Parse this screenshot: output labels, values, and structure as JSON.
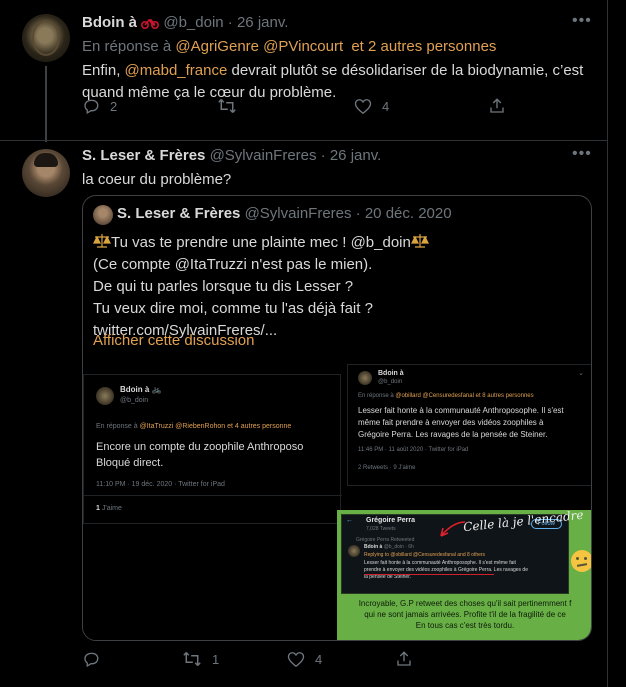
{
  "tweet1": {
    "name": "Bdoin à",
    "handle": "@b_doin",
    "sep": "·",
    "date": "26 janv.",
    "reply_prefix": "En réponse à",
    "reply_users": "@AgriGenre @PVincourt",
    "reply_others": "et 2 autres personnes",
    "text_a": "Enfin,",
    "mention": "@mabd_france",
    "text_b": "devrait plutôt se désolidariser de la biodynamie, c’est",
    "text_c": "quand même ça le cœur du problème.",
    "reply_count": "2",
    "like_count": "4"
  },
  "tweet2": {
    "name": "S. Leser & Frères",
    "handle": "@SylvainFreres",
    "sep": "·",
    "date": "26 janv.",
    "text": "la coeur du problème?",
    "retweet_count": "1",
    "like_count": "4"
  },
  "quote": {
    "name": "S. Leser & Frères",
    "handle": "@SylvainFreres",
    "sep": "·",
    "date": "20 déc. 2020",
    "line1": "Tu vas te prendre une plainte mec ! @b_doin",
    "line2": "(Ce compte @ItaTruzzi n'est pas le mien).",
    "line3": "De qui tu parles lorsque tu dis Lesser ?",
    "line4": "Tu veux dire moi, comme tu l'as déjà fait ?",
    "link": "twitter.com/SylvainFreres/...",
    "show_thread": "Afficher cette discussion"
  },
  "shot_left": {
    "name": "Bdoin à",
    "handle": "@b_doin",
    "reply_prefix": "En réponse à",
    "reply_users": "@ItaTruzzi @RiebenRohon",
    "reply_others": "et 4 autres personne",
    "line1": "Encore un compte du zoophile Anthroposo",
    "line2": "Bloqué direct.",
    "meta": "11:10 PM · 19 déc. 2020 · Twitter for iPad",
    "likes": "1",
    "likes_label": "J'aime"
  },
  "shot_right": {
    "name": "Bdoin à",
    "handle": "@b_doin",
    "reply_prefix": "En réponse à",
    "reply_users": "@obillard @Censuredesfanal",
    "reply_others": "et 8 autres personnes",
    "line1": "Lesser fait honte à la communauté Anthroposophe. Il s'est",
    "line2": "même fait prendre à envoyer des vidéos zoophiles à",
    "line3": "Grégoire Perra. Les ravages de la pensée de Steiner.",
    "meta": "11:46 PM · 11 août 2020 · Twitter for iPad",
    "stats": "2 Retweets · 9 J'aime"
  },
  "shot_green": {
    "profile_name": "Grégoire Perra",
    "profile_sub": "7,028 Tweets",
    "follow": "Follow",
    "annotation": "Celle là je l'encadre",
    "retweeted": "Grégoire Perra Retweeted",
    "inner_name": "Bdoin à",
    "inner_handle": "@b_doin · 6h",
    "inner_reply": "Replying to @obillard @Censuredesfanal and 8 others",
    "inner_l1": "Lesser fait honte à la communauté Anthroposophe. Il s'est même fait",
    "inner_l2": "prendre à envoyer des vidéos zoophiles à Grégoire Perra. Les ravages de",
    "inner_l3": "la pensée de Steiner.",
    "caption1": "Incroyable, G.P retweet des choses qu'il sait pertinemment f",
    "caption2": "qui ne sont jamais arrivées. Profite t'il de la fragilité de ce",
    "caption3": "En tous cas c'est très tordu."
  },
  "colors": {
    "accent": "#e0a052",
    "muted": "#6e767d",
    "green": "#68b046"
  }
}
